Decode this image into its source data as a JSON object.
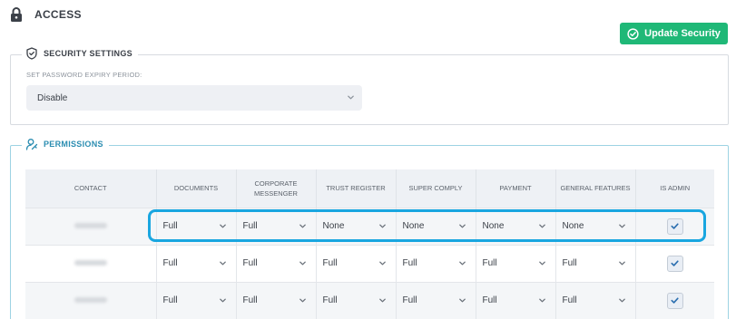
{
  "header": {
    "title": "ACCESS",
    "icon": "lock-icon"
  },
  "actions": {
    "update_label": "Update Security",
    "update_color": "#1fb877"
  },
  "security": {
    "legend": "SECURITY SETTINGS",
    "expiry_label": "SET PASSWORD EXPIRY PERIOD:",
    "expiry_value": "Disable"
  },
  "permissions": {
    "legend": "PERMISSIONS",
    "columns": [
      "CONTACT",
      "DOCUMENTS",
      "CORPORATE MESSENGER",
      "TRUST REGISTER",
      "SUPER COMPLY",
      "PAYMENT",
      "GENERAL FEATURES",
      "IS ADMIN"
    ],
    "rows": [
      {
        "values": [
          "Full",
          "Full",
          "None",
          "None",
          "None",
          "None"
        ],
        "is_admin": true
      },
      {
        "values": [
          "Full",
          "Full",
          "Full",
          "Full",
          "Full",
          "Full"
        ],
        "is_admin": true
      },
      {
        "values": [
          "Full",
          "Full",
          "Full",
          "Full",
          "Full",
          "Full"
        ],
        "is_admin": true
      }
    ]
  },
  "colors": {
    "accent": "#2b8db1",
    "highlight": "#19a6e0"
  }
}
